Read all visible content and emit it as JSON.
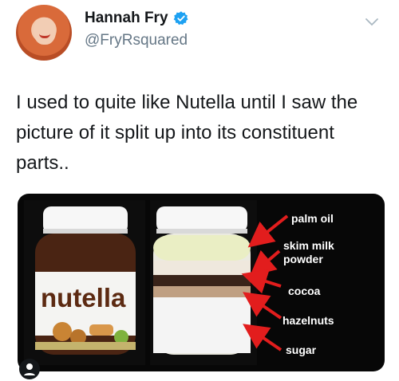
{
  "tweet": {
    "display_name": "Hannah Fry",
    "handle": "@FryRsquared",
    "text": "I used to quite like Nutella until I saw the picture of it split up into its constituent parts.."
  },
  "media": {
    "brand_text": "nutella",
    "labels": [
      "palm oil",
      "skim milk\npowder",
      "cocoa",
      "hazelnuts",
      "sugar"
    ]
  },
  "icons": {
    "verified": "verified-badge-icon",
    "chevron": "chevron-down-icon",
    "user": "user-icon"
  },
  "colors": {
    "verified_blue": "#1da1f2",
    "handle_gray": "#657786",
    "media_bg": "#070707",
    "jar_lid": "#ffffff",
    "nutella_brown": "#4a2413",
    "arrow_red": "#e21d1d"
  }
}
